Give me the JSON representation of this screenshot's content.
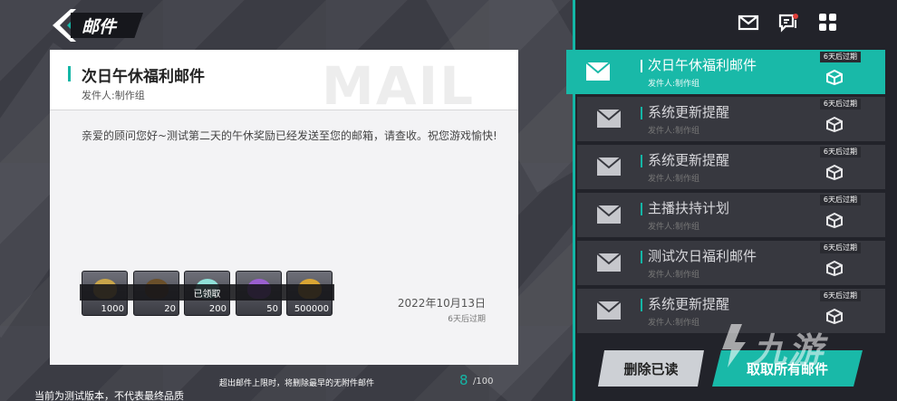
{
  "header": {
    "title": "邮件"
  },
  "top_icons": [
    "mail-icon",
    "chat-icon",
    "grid-menu-icon"
  ],
  "card": {
    "title": "次日午休福利邮件",
    "sender": "发件人:制作组",
    "watermark": "MAIL",
    "body": "亲爱的顾问您好~测试第二天的午休奖励已经发送至您的邮箱，请查收。祝您游戏愉快!",
    "attachments": [
      {
        "count": "1000",
        "color": "#c9a54a"
      },
      {
        "count": "20",
        "color": "#6a4f2a"
      },
      {
        "count": "200",
        "color": "#8fe0d8"
      },
      {
        "count": "50",
        "color": "#9b5fd0"
      },
      {
        "count": "500000",
        "color": "#d9a534"
      }
    ],
    "claimed_label": "已领取",
    "date": "2022年10月13日",
    "expire": "6天后过期"
  },
  "footer": {
    "note": "超出邮件上限时，将删除最早的无附件邮件",
    "count_current": "8",
    "count_max": "/100",
    "version_note": "当前为测试版本，不代表最终品质"
  },
  "mail_list": [
    {
      "title": "次日午休福利邮件",
      "sender": "发件人:制作组",
      "expire": "6天后过期",
      "active": true
    },
    {
      "title": "系统更新提醒",
      "sender": "发件人:制作组",
      "expire": "6天后过期",
      "active": false
    },
    {
      "title": "系统更新提醒",
      "sender": "发件人:制作组",
      "expire": "6天后过期",
      "active": false
    },
    {
      "title": "主播扶持计划",
      "sender": "发件人:制作组",
      "expire": "6天后过期",
      "active": false
    },
    {
      "title": "测试次日福利邮件",
      "sender": "发件人:制作组",
      "expire": "6天后过期",
      "active": false
    },
    {
      "title": "系统更新提醒",
      "sender": "发件人:制作组",
      "expire": "6天后过期",
      "active": false
    }
  ],
  "buttons": {
    "delete_read": "删除已读",
    "claim_all": "取取所有邮件"
  },
  "watermark": {
    "text": "九游"
  },
  "colors": {
    "accent": "#19b9a8",
    "panel_dark": "#22232a",
    "list_item": "#37383f"
  }
}
